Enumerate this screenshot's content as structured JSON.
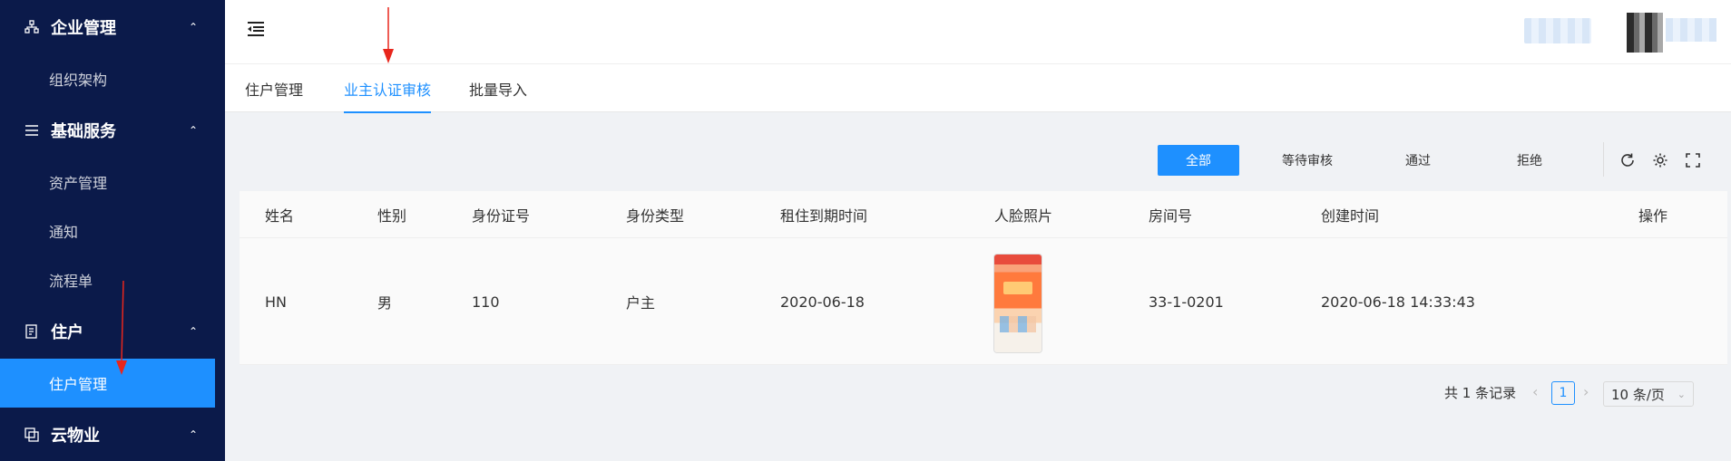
{
  "sidebar": {
    "groups": [
      {
        "icon": "org-chart-icon",
        "label": "企业管理",
        "items": [
          "组织架构"
        ]
      },
      {
        "icon": "list-icon",
        "label": "基础服务",
        "items": [
          "资产管理",
          "通知",
          "流程单"
        ]
      },
      {
        "icon": "document-icon",
        "label": "住户",
        "items": [
          "住户管理"
        ]
      },
      {
        "icon": "copy-icon",
        "label": "云物业",
        "items": []
      }
    ],
    "active_item": "住户管理"
  },
  "header": {
    "fold_icon": "menu-fold-icon"
  },
  "tabs": [
    {
      "label": "住户管理"
    },
    {
      "label": "业主认证审核",
      "active": true
    },
    {
      "label": "批量导入"
    }
  ],
  "filters": [
    {
      "label": "全部",
      "active": true
    },
    {
      "label": "等待审核"
    },
    {
      "label": "通过"
    },
    {
      "label": "拒绝"
    }
  ],
  "tools": [
    "reload-icon",
    "settings-icon",
    "fullscreen-icon"
  ],
  "table": {
    "columns": [
      "姓名",
      "性别",
      "身份证号",
      "身份类型",
      "租住到期时间",
      "人脸照片",
      "房间号",
      "创建时间",
      "操作"
    ],
    "rows": [
      {
        "name": "HN",
        "gender": "男",
        "id_no": "110",
        "id_type": "户主",
        "expire": "2020-06-18",
        "room": "33-1-0201",
        "created": "2020-06-18 14:33:43"
      }
    ]
  },
  "pagination": {
    "total": "共 1 条记录",
    "current": "1",
    "page_size": "10 条/页"
  },
  "colors": {
    "sidebar": "#0b1a4a",
    "accent": "#1e90ff",
    "annotation": "#e8261c"
  }
}
